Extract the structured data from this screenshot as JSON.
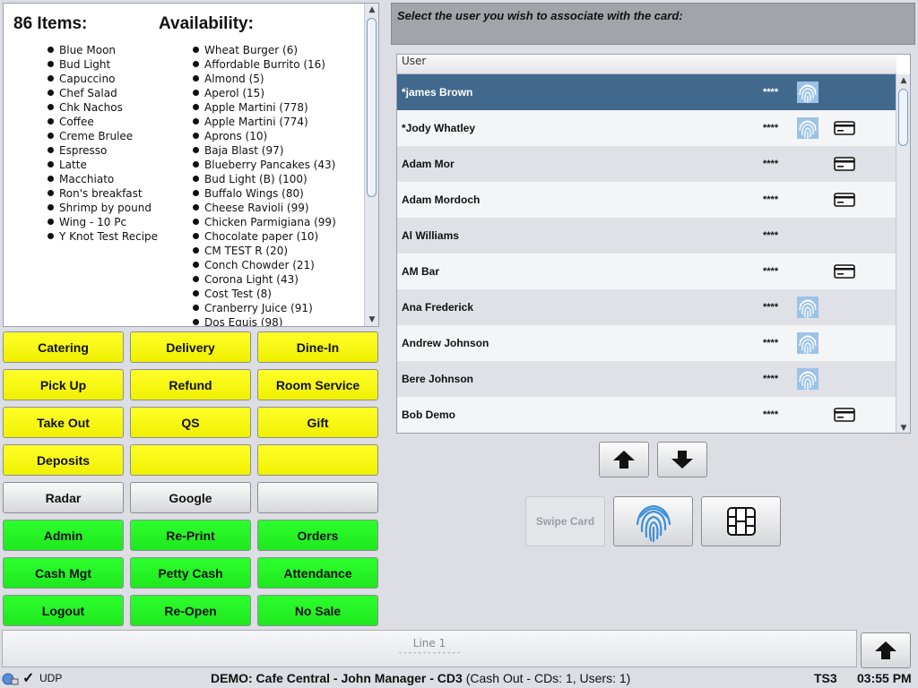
{
  "info_panel": {
    "items_heading": "86 Items:",
    "availability_heading": "Availability:",
    "items": [
      "Blue Moon",
      "Bud Light",
      "Capuccino",
      "Chef Salad",
      "Chk Nachos",
      "Coffee",
      "Creme Brulee",
      "Espresso",
      "Latte",
      "Macchiato",
      "Ron's breakfast",
      "Shrimp by pound",
      "Wing - 10 Pc",
      "Y Knot Test Recipe"
    ],
    "availability": [
      "Wheat Burger (6)",
      "Affordable Burrito (16)",
      "Almond (5)",
      "Aperol (15)",
      "Apple Martini (778)",
      "Apple Martini (774)",
      "Aprons (10)",
      "Baja Blast (97)",
      "Blueberry Pancakes (43)",
      "Bud Light (B) (100)",
      "Buffalo Wings (80)",
      "Cheese Ravioli (99)",
      "Chicken Parmigiana (99)",
      "Chocolate paper (10)",
      "CM TEST R (20)",
      "Conch Chowder (21)",
      "Corona Light (43)",
      "Cost Test (8)",
      "Cranberry Juice (91)",
      "Dos Equis (98)"
    ]
  },
  "buttons": [
    [
      "Catering",
      "Delivery",
      "Dine-In"
    ],
    [
      "Pick Up",
      "Refund",
      "Room Service"
    ],
    [
      "Take Out",
      "QS",
      "Gift"
    ],
    [
      "Deposits",
      "",
      ""
    ],
    [
      "Radar",
      "Google",
      ""
    ],
    [
      "Admin",
      "Re-Print",
      "Orders"
    ],
    [
      "Cash Mgt",
      "Petty Cash",
      "Attendance"
    ],
    [
      "Logout",
      "Re-Open",
      "No Sale"
    ]
  ],
  "button_colors": {
    "yellow": "#ffff00",
    "green": "#22ff22",
    "gray": "#e0e0e0"
  },
  "prompt": "Select the user you wish to associate with the card:",
  "user_table": {
    "header": "User",
    "selected_color": "#41698e",
    "rows": [
      {
        "name": "*james Brown",
        "pin": "****",
        "fingerprint": true,
        "card": false
      },
      {
        "name": "*Jody Whatley",
        "pin": "****",
        "fingerprint": true,
        "card": true
      },
      {
        "name": "Adam  Mor",
        "pin": "****",
        "fingerprint": false,
        "card": true
      },
      {
        "name": "Adam  Mordoch",
        "pin": "****",
        "fingerprint": false,
        "card": true
      },
      {
        "name": "Al Williams",
        "pin": "****",
        "fingerprint": false,
        "card": false
      },
      {
        "name": "AM Bar",
        "pin": "****",
        "fingerprint": false,
        "card": true
      },
      {
        "name": "Ana Frederick",
        "pin": "****",
        "fingerprint": true,
        "card": false
      },
      {
        "name": "Andrew Johnson",
        "pin": "****",
        "fingerprint": true,
        "card": false
      },
      {
        "name": "Bere Johnson",
        "pin": "****",
        "fingerprint": true,
        "card": false
      },
      {
        "name": "Bob Demo",
        "pin": "****",
        "fingerprint": false,
        "card": true
      }
    ]
  },
  "actions": {
    "swipe_card_label": "Swipe Card"
  },
  "line_bar": {
    "label": "Line 1",
    "dashes": "-------------"
  },
  "status_bar": {
    "udp_label": "UDP",
    "main": "DEMO: Cafe Central - John Manager - CD3",
    "detail": "(Cash Out - CDs: 1, Users: 1)",
    "terminal": "TS3",
    "time": "03:55 PM"
  }
}
